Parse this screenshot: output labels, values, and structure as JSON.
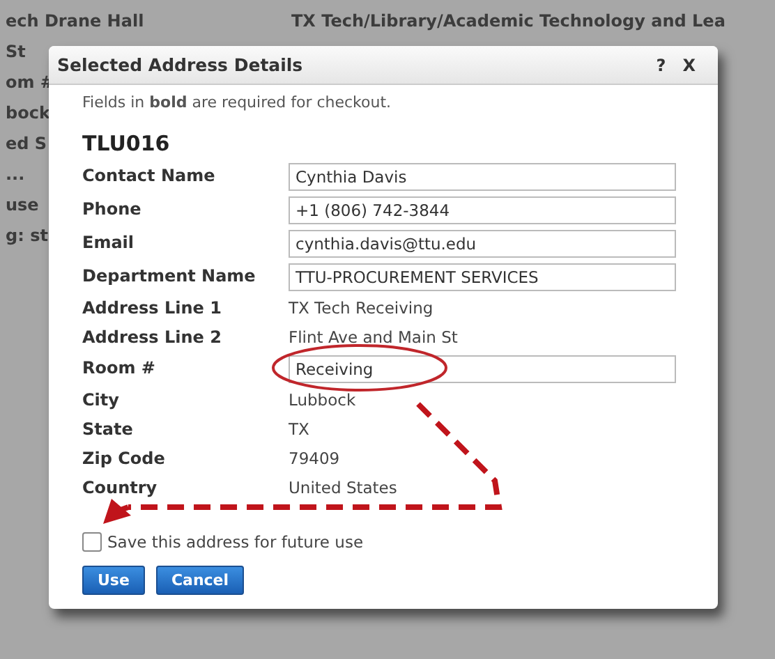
{
  "background": {
    "lines": [
      {
        "left": "ech Drane Hall",
        "right": "TX Tech/Library/Academic Technology and Lea"
      },
      {
        "left": "St"
      },
      {
        "left": "om #"
      },
      {
        "left": "bock"
      },
      {
        "left": "ed S"
      },
      {
        "left": "..."
      },
      {
        "left": "use"
      },
      {
        "left": "g: st"
      }
    ]
  },
  "dialog": {
    "title": "Selected Address Details",
    "help": "?",
    "close": "X",
    "note": "Fields in **bold** are required for checkout.",
    "code": "TLU016",
    "fields": [
      {
        "label": "Contact Name",
        "kind": "input",
        "value": "Cynthia Davis"
      },
      {
        "label": "Phone",
        "kind": "input",
        "value": "+1 (806) 742-3844"
      },
      {
        "label": "Email",
        "kind": "input",
        "value": "cynthia.davis@ttu.edu"
      },
      {
        "label": "Department Name",
        "kind": "input",
        "value": "TTU-PROCUREMENT SERVICES"
      },
      {
        "label": "Address Line 1",
        "kind": "text",
        "value": "TX Tech Receiving"
      },
      {
        "label": "Address Line 2",
        "kind": "text",
        "value": "Flint Ave and Main St"
      },
      {
        "label": "Room #",
        "kind": "input",
        "value": "Receiving",
        "highlighted": true
      },
      {
        "label": "City",
        "kind": "text",
        "value": "Lubbock"
      },
      {
        "label": "State",
        "kind": "text",
        "value": "TX"
      },
      {
        "label": "Zip Code",
        "kind": "text",
        "value": "79409"
      },
      {
        "label": "Country",
        "kind": "text",
        "value": "United States"
      }
    ],
    "save": {
      "label": "Save this address for future use",
      "checked": false
    },
    "buttons": [
      "Use",
      "Cancel"
    ]
  }
}
